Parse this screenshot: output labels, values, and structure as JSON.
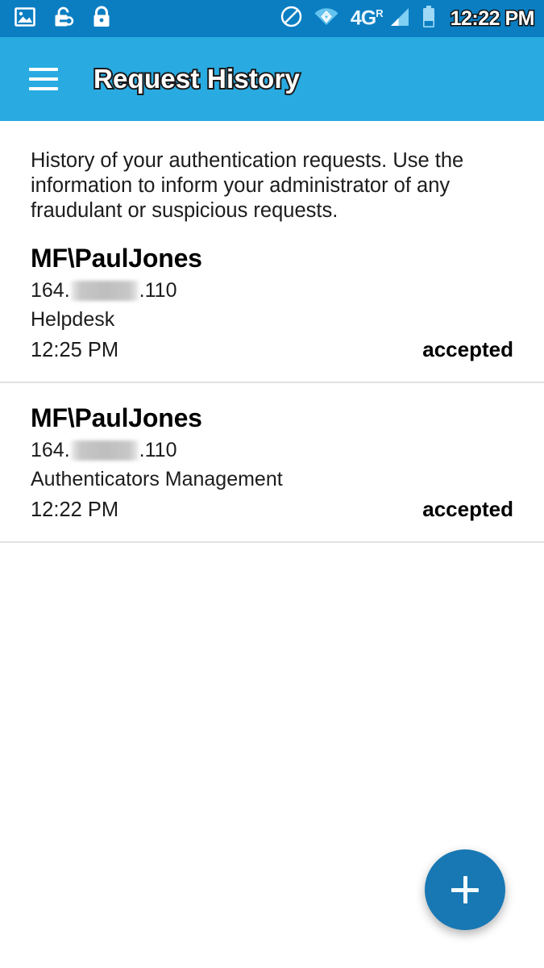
{
  "status_bar": {
    "time": "12:22 PM",
    "network_label": "4G",
    "network_superscript": "R",
    "icons_left": [
      "image-icon",
      "unlock-key-icon",
      "lock-icon"
    ],
    "icons_right": [
      "do-not-disturb-icon",
      "wifi-icon",
      "network-4g-icon",
      "signal-bars-icon",
      "battery-icon"
    ],
    "background_color": "#0b7ec2"
  },
  "app_bar": {
    "title": "Request History",
    "menu_icon": "hamburger-menu-icon",
    "background_color": "#29abe2"
  },
  "main": {
    "intro_text": "History of your authentication requests. Use the information to inform your administrator of any fraudulant or suspicious requests.",
    "requests": [
      {
        "user": "MF\\PaulJones",
        "ip_prefix": "164.",
        "ip_redacted": "",
        "ip_suffix": ".110",
        "target": "Helpdesk",
        "time": "12:25 PM",
        "status": "accepted"
      },
      {
        "user": "MF\\PaulJones",
        "ip_prefix": "164.",
        "ip_redacted": "",
        "ip_suffix": ".110",
        "target": "Authenticators Management",
        "time": "12:22 PM",
        "status": "accepted"
      }
    ]
  },
  "fab": {
    "icon": "plus-icon",
    "color": "#1878b4"
  }
}
